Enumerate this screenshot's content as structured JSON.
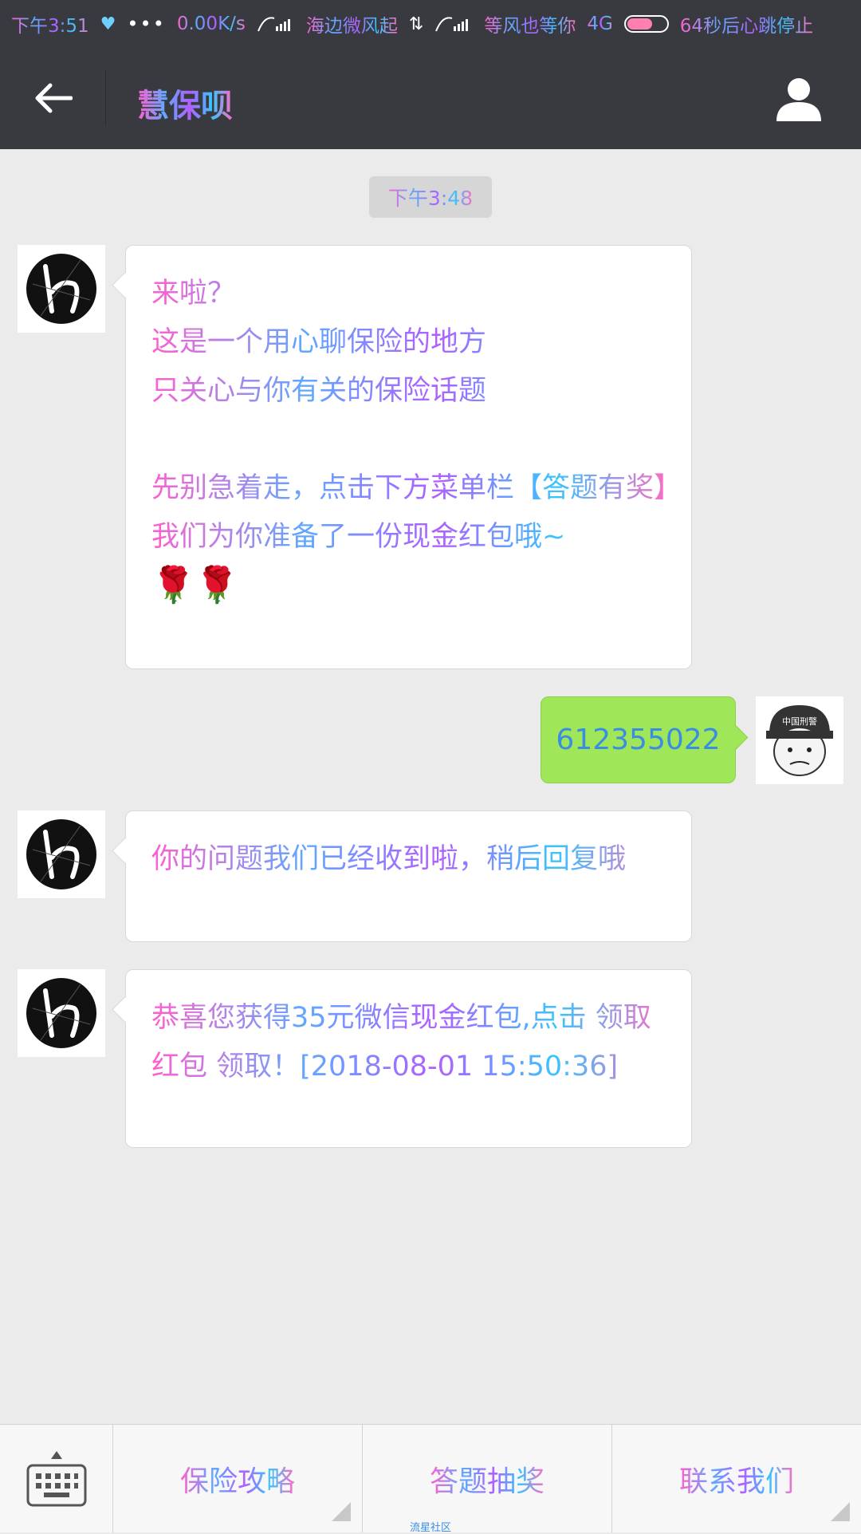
{
  "status_bar": {
    "time": "下午3:51",
    "speed": "0.00K/s",
    "carrier1": "海边微风起",
    "carrier2": "等风也等你",
    "network": "4G",
    "battery_text": "64秒后心跳停止"
  },
  "header": {
    "title": "慧保呗",
    "back_icon": "arrow-left-icon",
    "profile_icon": "person-icon"
  },
  "chat": {
    "timestamp": "下午3:48",
    "messages": [
      {
        "sender": "bot",
        "lines": [
          "来啦？",
          "这是一个用心聊保险的地方",
          "只关心与你有关的保险话题",
          "",
          "先别急着走，点击下方菜单栏【答题有奖】",
          "我们为你准备了一份现金红包哦~",
          "🌹🌹"
        ]
      },
      {
        "sender": "user",
        "text": "612355022"
      },
      {
        "sender": "bot",
        "text": "你的问题我们已经收到啦，稍后回复哦"
      },
      {
        "sender": "bot",
        "text": "恭喜您获得35元微信现金红包,点击 领取红包 领取！[2018-08-01 15:50:36]"
      }
    ],
    "user_avatar_text": "中国刑警"
  },
  "menu": {
    "keyboard_icon": "keyboard-icon",
    "items": [
      "保险攻略",
      "答题抽奖",
      "联系我们"
    ]
  },
  "watermark": "流星社区",
  "colors": {
    "titlebar": "#393a3f",
    "chat_bg": "#ebebeb",
    "outgoing_bubble": "#9fe658",
    "accent_blue": "#3a8de0",
    "accent_pink": "#ff5fd0"
  }
}
